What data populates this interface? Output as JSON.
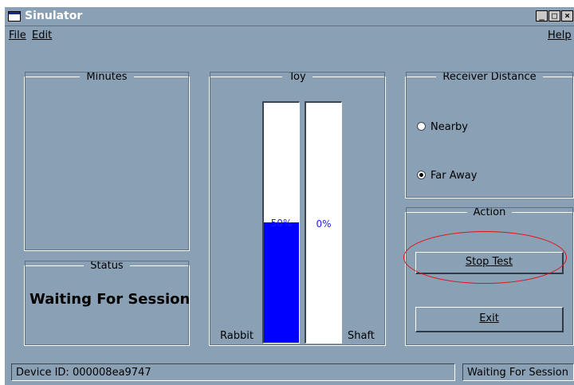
{
  "window": {
    "title": "Sinulator"
  },
  "menubar": {
    "file": "File",
    "edit": "Edit",
    "help": "Help"
  },
  "groups": {
    "minutes": "Minutes",
    "status": "Status",
    "toy": "Toy",
    "receiver": "Receiver Distance",
    "action": "Action"
  },
  "status": {
    "text": "Waiting For Session"
  },
  "toy": {
    "rabbit": {
      "label": "Rabbit",
      "percent": "50%",
      "level": 0.5
    },
    "shaft": {
      "label": "Shaft",
      "percent": "0%",
      "level": 0
    }
  },
  "receiver": {
    "options": [
      {
        "label": "Nearby",
        "selected": false
      },
      {
        "label": "Far Away",
        "selected": true
      }
    ]
  },
  "actions": {
    "stop": "Stop Test",
    "exit": "Exit"
  },
  "statusbar": {
    "device": "Device ID: 000008ea9747",
    "state": "Waiting For Session"
  },
  "colors": {
    "window_bg": "#8aa0b4",
    "bar_fill": "#0000ff",
    "annotation": "#e0121a"
  }
}
